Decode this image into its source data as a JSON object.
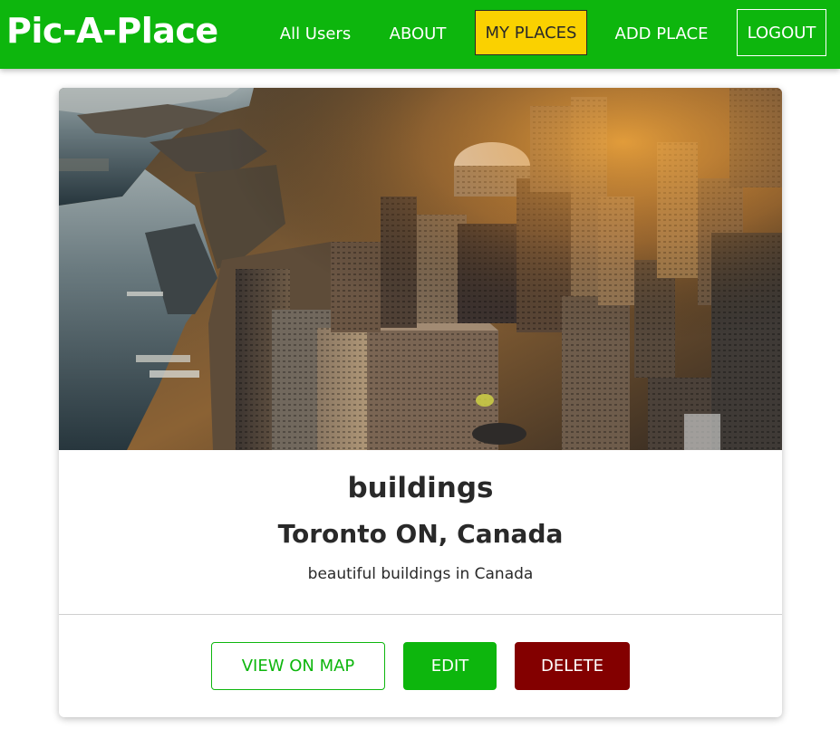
{
  "app": {
    "brand": "Pic-A-Place"
  },
  "nav": {
    "items": [
      {
        "label": "All Users",
        "active": false
      },
      {
        "label": "ABOUT",
        "active": false
      },
      {
        "label": "MY PLACES",
        "active": true
      },
      {
        "label": "ADD PLACE",
        "active": false
      },
      {
        "label": "LOGOUT",
        "active": false
      }
    ]
  },
  "place": {
    "title": "buildings",
    "address": "Toronto ON, Canada",
    "description": "beautiful buildings in Canada",
    "image_subject": "aerial-city-skyline-photo"
  },
  "actions": {
    "view_on_map": "VIEW ON MAP",
    "edit": "EDIT",
    "delete": "DELETE"
  },
  "colors": {
    "primary_green": "#0db60d",
    "active_yellow": "#fad100",
    "danger_red": "#830000",
    "text_dark": "#292929"
  }
}
